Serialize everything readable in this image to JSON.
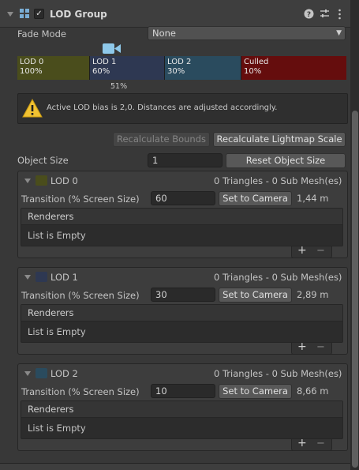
{
  "header": {
    "title": "LOD Group",
    "checked": true
  },
  "fade_mode": {
    "label": "Fade Mode",
    "value": "None"
  },
  "lod_bar": {
    "segments": [
      {
        "name": "LOD 0",
        "percent": "100%",
        "color": "#4a4d1c"
      },
      {
        "name": "LOD 1",
        "percent": "60%",
        "color": "#2e3852"
      },
      {
        "name": "LOD 2",
        "percent": "30%",
        "color": "#2a4b5e"
      },
      {
        "name": "Culled",
        "percent": "10%",
        "color": "#650d0d"
      }
    ],
    "camera_marker": "51%"
  },
  "warning": {
    "text": "Active LOD bias is 2,0. Distances are adjusted accordingly."
  },
  "actions": {
    "recalculate_bounds": "Recalculate Bounds",
    "recalculate_lightmap_scale": "Recalculate Lightmap Scale"
  },
  "object_size": {
    "label": "Object Size",
    "value": "1",
    "reset_label": "Reset Object Size"
  },
  "lods": [
    {
      "name": "LOD 0",
      "color": "#4a4d1c",
      "info": "0 Triangles  - 0 Sub Mesh(es)",
      "transition_label": "Transition (% Screen Size)",
      "transition_value": "60",
      "set_camera": "Set to Camera",
      "distance": "1,44 m",
      "renderers_label": "Renderers",
      "empty_label": "List is Empty",
      "add": "+",
      "remove": "−"
    },
    {
      "name": "LOD 1",
      "color": "#2e3852",
      "info": "0 Triangles  - 0 Sub Mesh(es)",
      "transition_label": "Transition (% Screen Size)",
      "transition_value": "30",
      "set_camera": "Set to Camera",
      "distance": "2,89 m",
      "renderers_label": "Renderers",
      "empty_label": "List is Empty",
      "add": "+",
      "remove": "−"
    },
    {
      "name": "LOD 2",
      "color": "#2a4b5e",
      "info": "0 Triangles  - 0 Sub Mesh(es)",
      "transition_label": "Transition (% Screen Size)",
      "transition_value": "10",
      "set_camera": "Set to Camera",
      "distance": "8,66 m",
      "renderers_label": "Renderers",
      "empty_label": "List is Empty",
      "add": "+",
      "remove": "−"
    }
  ],
  "icons": {
    "foldout": "triangle-down-icon",
    "component": "lod-group-icon",
    "help": "help-icon",
    "presets": "presets-icon",
    "menu": "kebab-menu-icon",
    "camera": "camera-icon",
    "warning": "warning-icon"
  }
}
